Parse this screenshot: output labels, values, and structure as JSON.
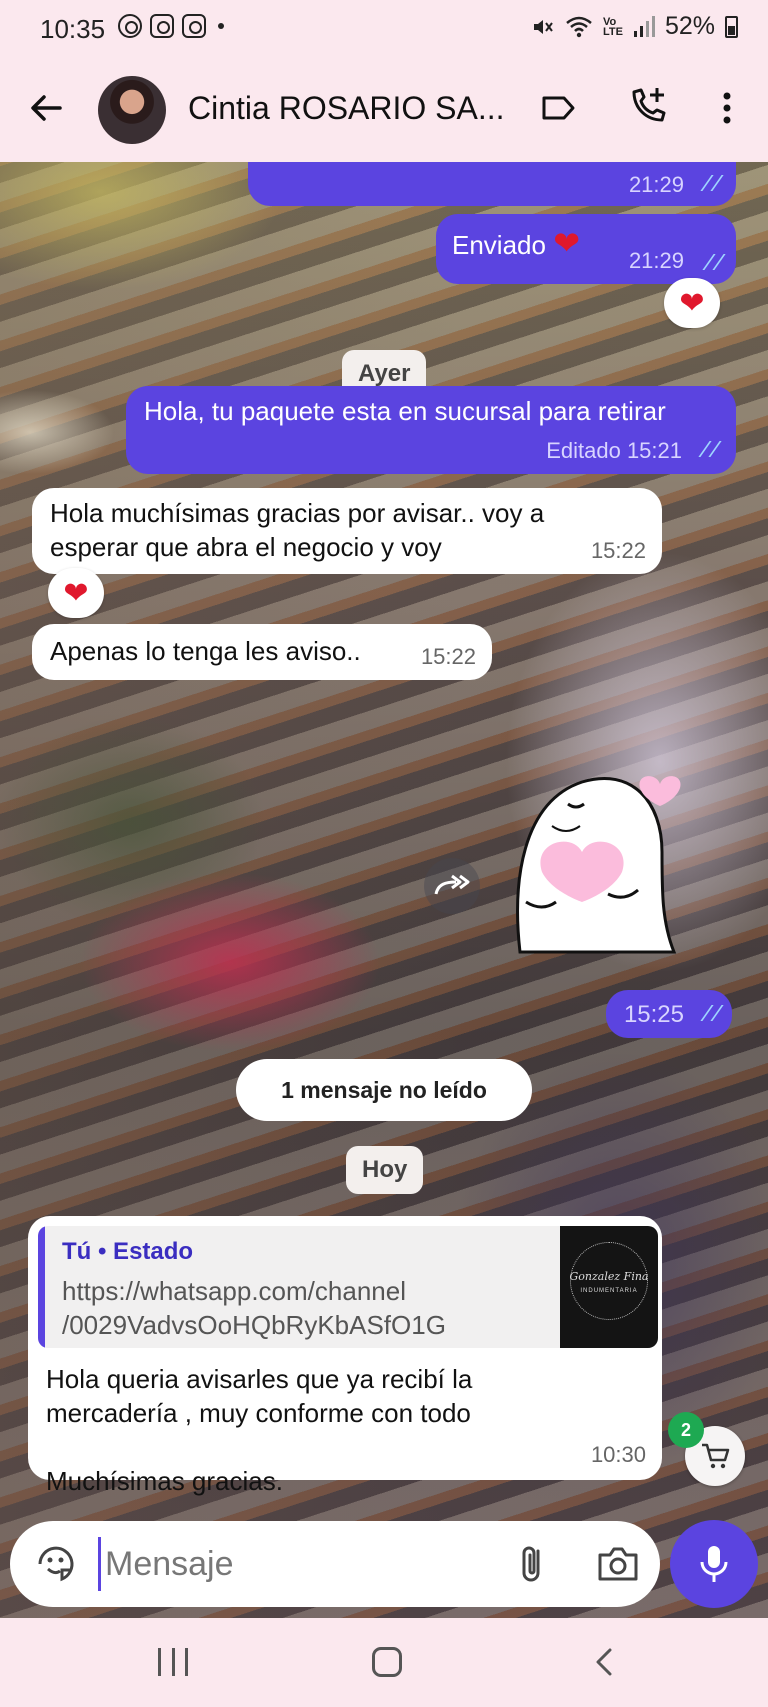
{
  "status_bar": {
    "time": "10:35",
    "battery": "52%",
    "network_label_top": "Vo",
    "network_label_bottom": "LTE"
  },
  "header": {
    "contact_name": "Cintia ROSARIO SA...",
    "icons": [
      "back-arrow-icon",
      "label-icon",
      "add-call-icon",
      "more-vert-icon"
    ]
  },
  "messages": {
    "m1": {
      "direction": "out",
      "time": "21:29",
      "status": "read"
    },
    "m2": {
      "direction": "out",
      "text": "Enviado",
      "time": "21:29",
      "status": "read"
    },
    "m2_reaction": "❤",
    "date_ayer": "Ayer",
    "m3": {
      "direction": "out",
      "text": "Hola, tu paquete esta en sucursal para retirar",
      "edited_time": "Editado 15:21",
      "status": "read"
    },
    "m4": {
      "direction": "in",
      "line1": "Hola muchísimas gracias por avisar..  voy a",
      "line2": "esperar que abra el negocio y voy",
      "time": "15:22"
    },
    "m4_reaction": "❤",
    "m5": {
      "direction": "in",
      "text": "Apenas lo tenga les aviso..",
      "time": "15:22"
    },
    "m6": {
      "direction": "out",
      "type": "sticker",
      "time": "15:25",
      "status": "read"
    },
    "unread_chip": "1 mensaje no leído",
    "date_hoy": "Hoy",
    "m7": {
      "direction": "in",
      "quote_author": "Tú • Estado",
      "quote_line1": "https://whatsapp.com/channel",
      "quote_line2": "/0029VadvsOoHQbRyKbASfO1G",
      "line1": "Hola queria  avisarles que ya recibí  la",
      "line2": "mercadería , muy conforme con todo",
      "line3": "Muchísimas gracias.",
      "time": "10:30"
    }
  },
  "cart": {
    "badge_count": "2"
  },
  "composer": {
    "placeholder": "Mensaje"
  },
  "colors": {
    "accent": "#5b44e0",
    "header_bg": "#fbe8ee",
    "incoming_bubble": "#ffffff",
    "badge_green": "#1ea952",
    "reaction_red": "#e0182d"
  }
}
